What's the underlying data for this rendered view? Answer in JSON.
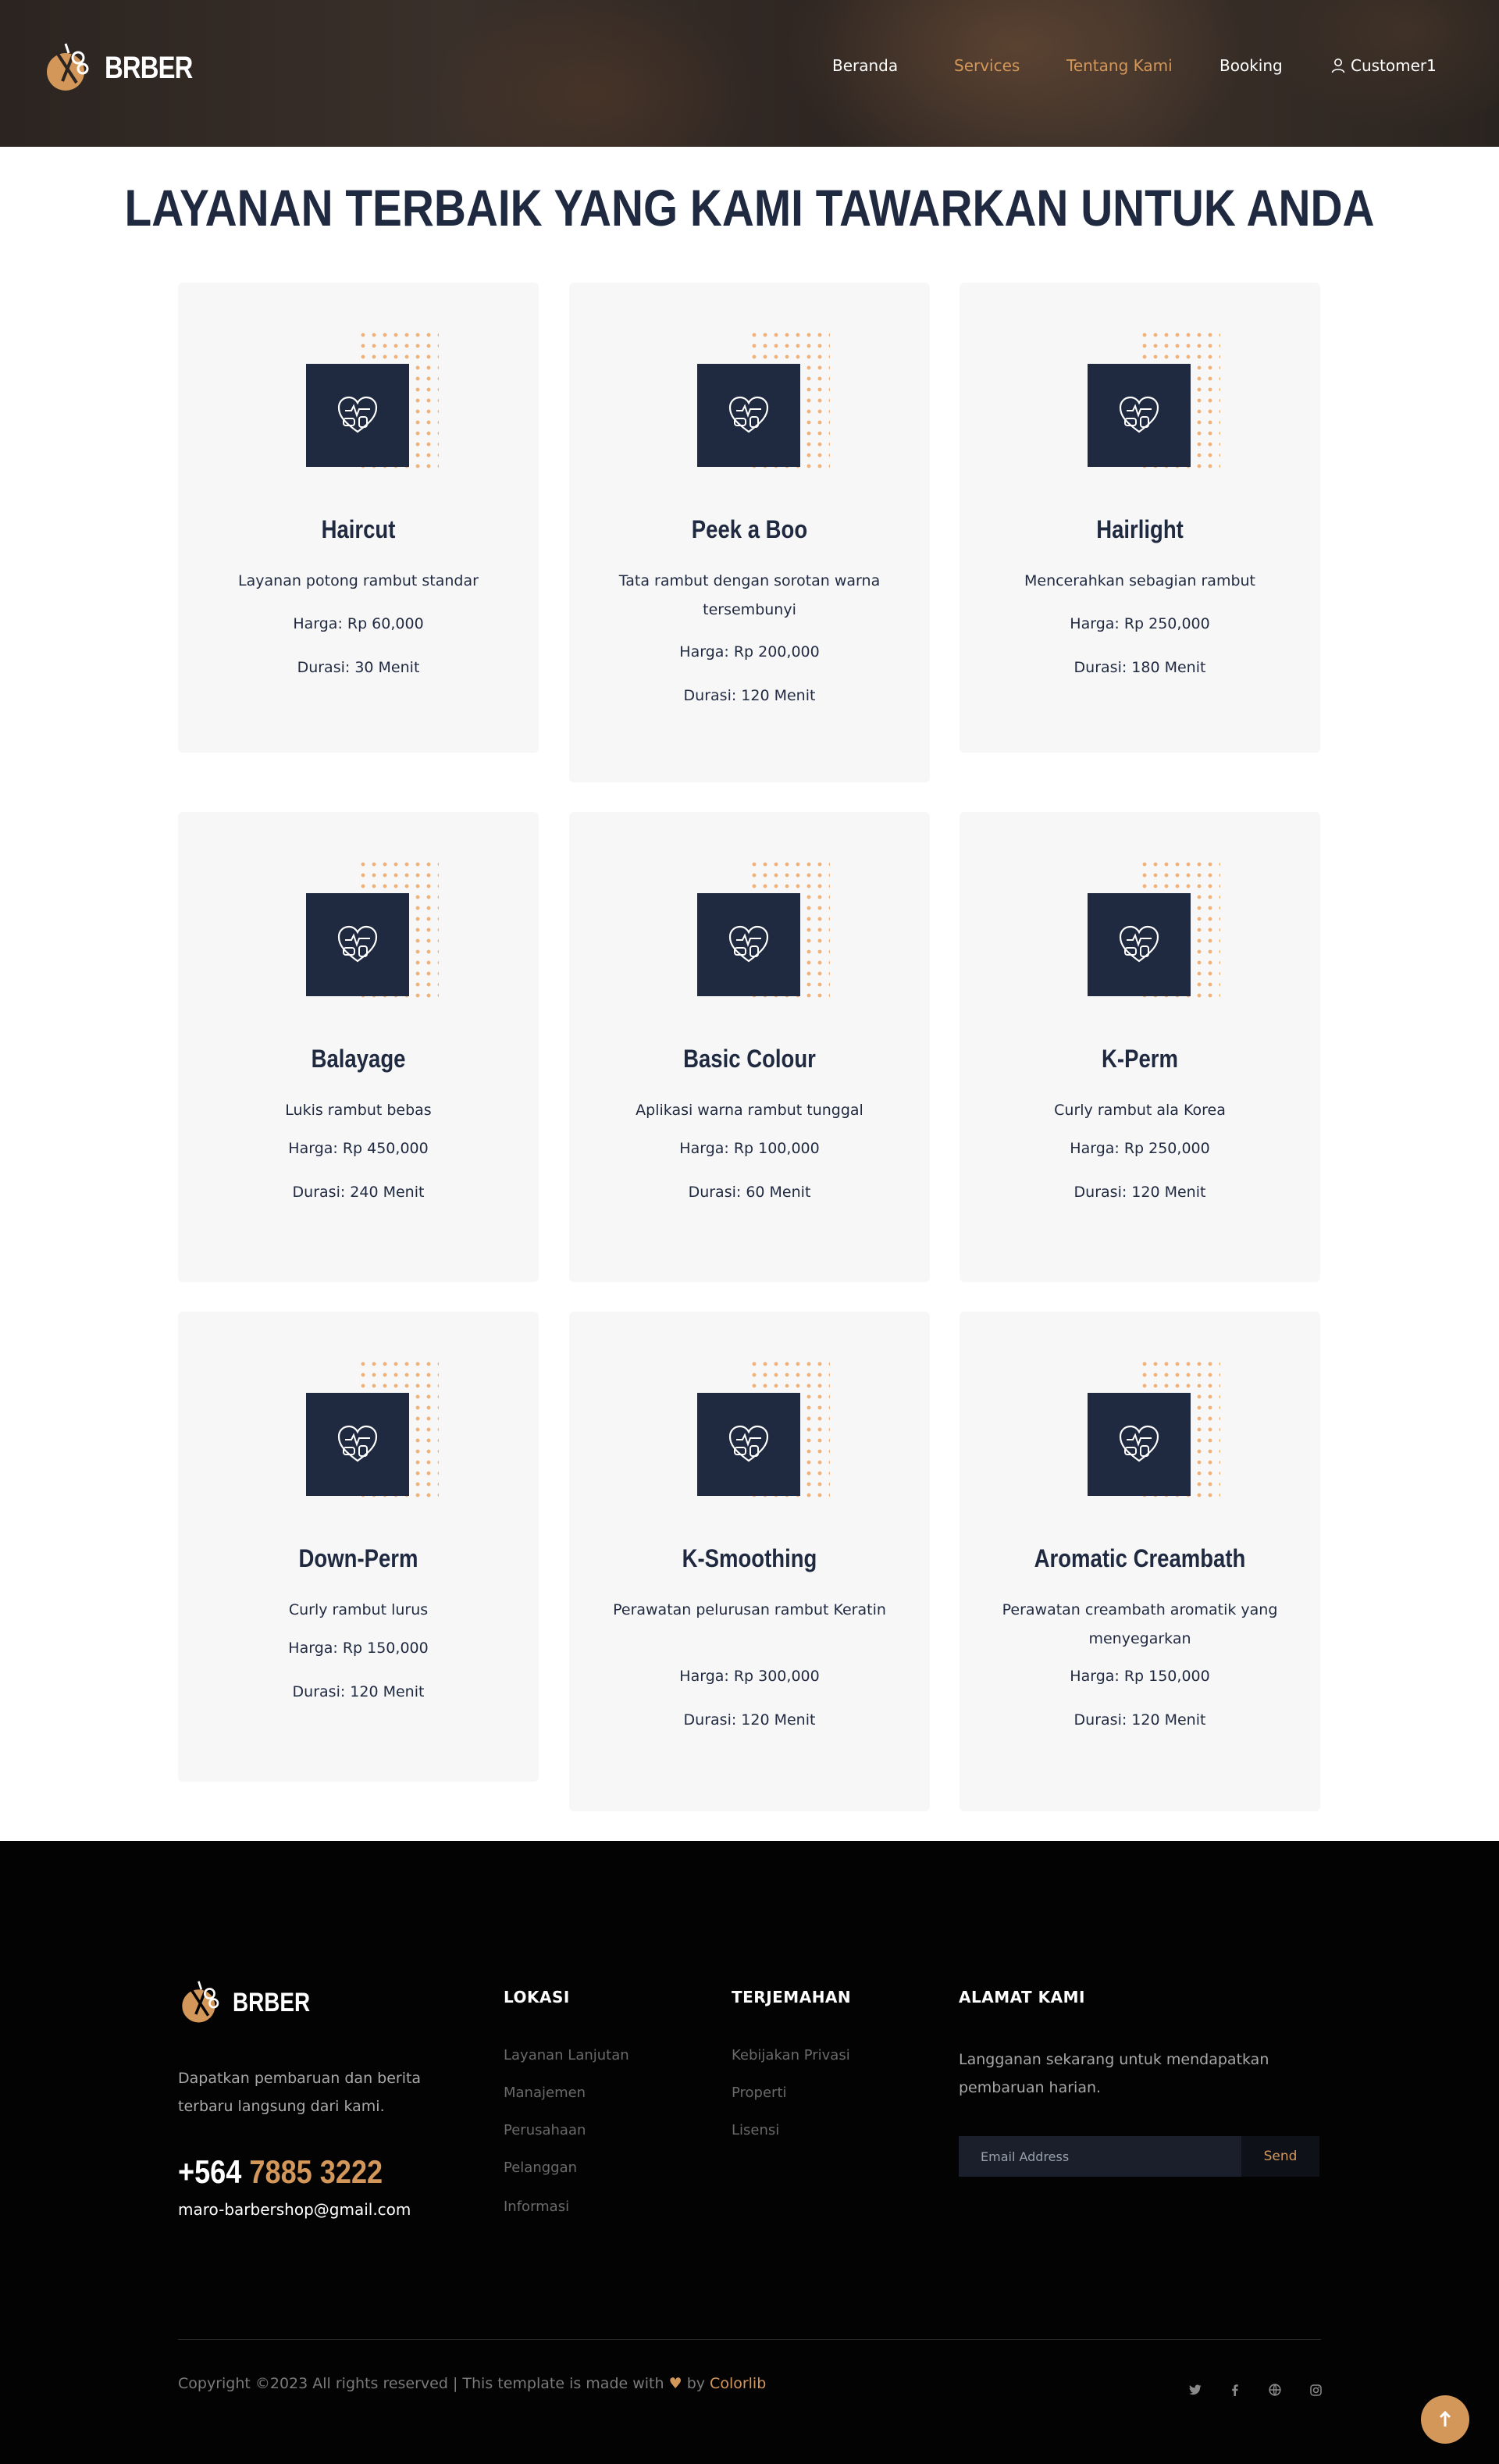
{
  "header": {
    "brand": "BRBER",
    "nav": [
      {
        "label": "Beranda",
        "active": false
      },
      {
        "label": "Services",
        "active": true
      },
      {
        "label": "Tentang Kami",
        "active": true
      },
      {
        "label": "Booking",
        "active": false
      }
    ],
    "user": "Customer1"
  },
  "main": {
    "title": "LAYANAN TERBAIK YANG KAMI TAWARKAN UNTUK ANDA"
  },
  "services": [
    {
      "name": "Haircut",
      "desc": "Layanan potong rambut standar",
      "price": "Harga: Rp 60,000",
      "duration": "Durasi: 30 Menit"
    },
    {
      "name": "Peek a Boo",
      "desc": "Tata rambut dengan sorotan warna tersembunyi",
      "price": "Harga: Rp 200,000",
      "duration": "Durasi: 120 Menit"
    },
    {
      "name": "Hairlight",
      "desc": "Mencerahkan sebagian rambut",
      "price": "Harga: Rp 250,000",
      "duration": "Durasi: 180 Menit"
    },
    {
      "name": "Balayage",
      "desc": "Lukis rambut bebas",
      "price": "Harga: Rp 450,000",
      "duration": "Durasi: 240 Menit"
    },
    {
      "name": "Basic Colour",
      "desc": "Aplikasi warna rambut tunggal",
      "price": "Harga: Rp 100,000",
      "duration": "Durasi: 60 Menit"
    },
    {
      "name": "K-Perm",
      "desc": "Curly rambut ala Korea",
      "price": "Harga: Rp 250,000",
      "duration": "Durasi: 120 Menit"
    },
    {
      "name": "Down-Perm",
      "desc": "Curly rambut lurus",
      "price": "Harga: Rp 150,000",
      "duration": "Durasi: 120 Menit"
    },
    {
      "name": "K-Smoothing",
      "desc": "Perawatan pelurusan rambut Keratin",
      "price": "Harga: Rp 300,000",
      "duration": "Durasi: 120 Menit"
    },
    {
      "name": "Aromatic Creambath",
      "desc": "Perawatan creambath aromatik yang menyegarkan",
      "price": "Harga: Rp 150,000",
      "duration": "Durasi: 120 Menit"
    }
  ],
  "footer": {
    "brand": "BRBER",
    "about": "Dapatkan pembaruan dan berita terbaru langsung dari kami.",
    "phone_prefix": "+564",
    "phone_number": "7885 3222",
    "email": "maro-barbershop@gmail.com",
    "columns": [
      {
        "title": "LOKASI",
        "links": [
          "Layanan Lanjutan",
          "Manajemen",
          "Perusahaan",
          "Pelanggan",
          "Informasi"
        ]
      },
      {
        "title": "TERJEMAHAN",
        "links": [
          "Kebijakan Privasi",
          "Properti",
          "Lisensi"
        ]
      }
    ],
    "newsletter": {
      "title": "ALAMAT KAMI",
      "text": "Langganan sekarang untuk mendapatkan pembaruan harian.",
      "placeholder": "Email Address",
      "button": "Send"
    },
    "copyright_prefix": "Copyright ©2023 All rights reserved | This template is made with",
    "copyright_by": "by",
    "copyright_brand": "Colorlib",
    "social": [
      "twitter-icon",
      "facebook-icon",
      "globe-icon",
      "instagram-icon"
    ]
  },
  "colors": {
    "accent": "#d4975a",
    "navy": "#1f2940",
    "card_bg": "#f7f7f7",
    "footer_bg": "#030303"
  }
}
